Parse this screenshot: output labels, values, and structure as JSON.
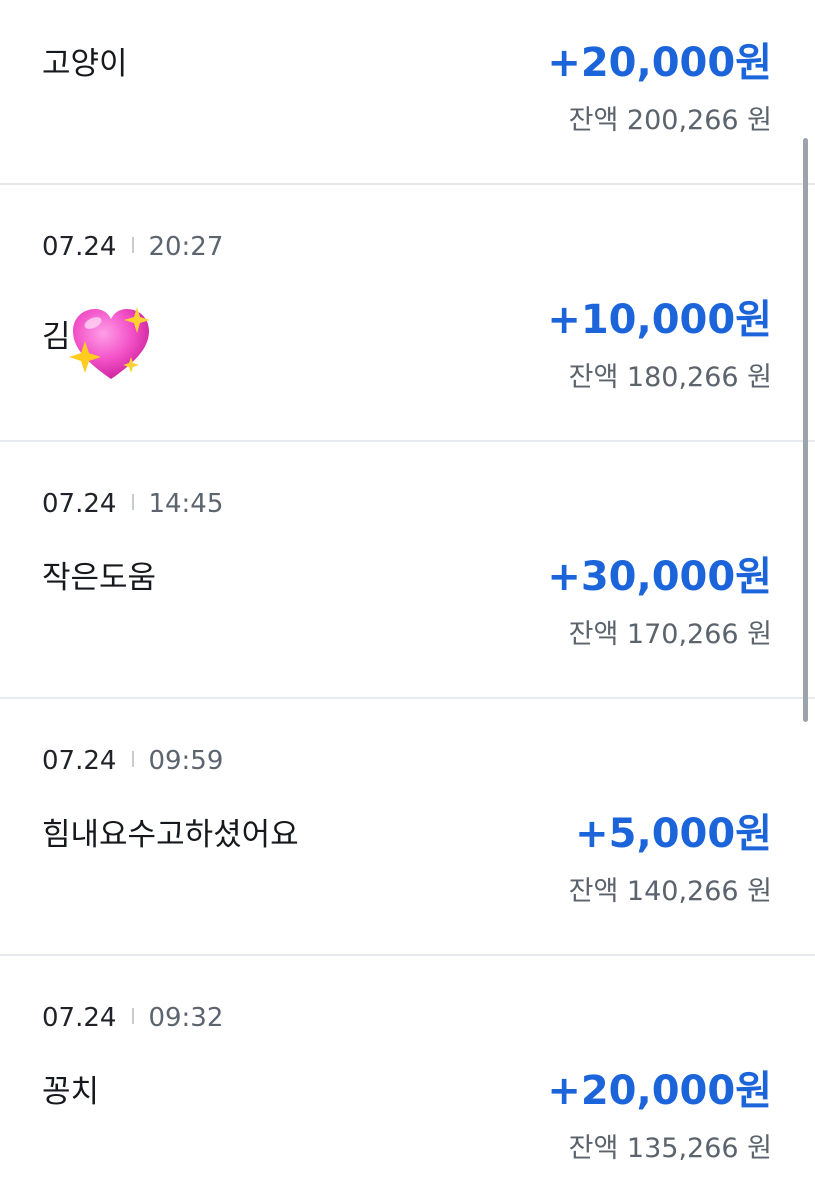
{
  "transactions": [
    {
      "date": "",
      "time": "",
      "name": "고양이",
      "name_emoji": "",
      "amount": "+20,000원",
      "balance": "잔액 200,266 원"
    },
    {
      "date": "07.24",
      "time": "20:27",
      "name": "김",
      "name_emoji": "sparkling-heart-icon",
      "amount": "+10,000원",
      "balance": "잔액 180,266 원"
    },
    {
      "date": "07.24",
      "time": "14:45",
      "name": "작은도움",
      "name_emoji": "",
      "amount": "+30,000원",
      "balance": "잔액 170,266 원"
    },
    {
      "date": "07.24",
      "time": "09:59",
      "name": "힘내요수고하셨어요",
      "name_emoji": "",
      "amount": "+5,000원",
      "balance": "잔액 140,266 원"
    },
    {
      "date": "07.24",
      "time": "09:32",
      "name": "꽁치",
      "name_emoji": "",
      "amount": "+20,000원",
      "balance": "잔액 135,266 원"
    }
  ],
  "colors": {
    "amount": "#1b64da",
    "balance": "#5b636d",
    "divider": "#e6eaee"
  }
}
